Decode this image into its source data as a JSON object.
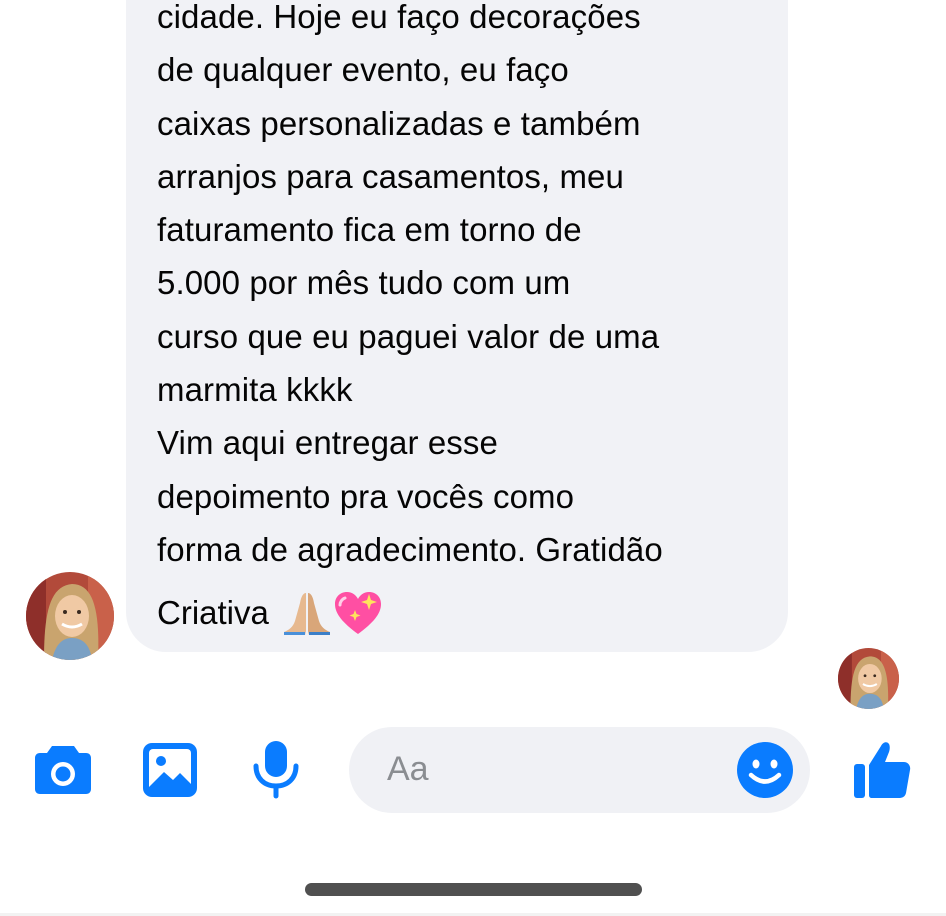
{
  "message": {
    "text": "cidade. Hoje eu faço decorações\nde qualquer evento, eu faço\ncaixas personalizadas e também\narranjos para casamentos, meu\nfaturamento fica em torno de\n5.000 por mês tudo com um\ncurso que eu paguei valor de uma\nmarmita kkkk\nVim aqui entregar esse\ndepoimento pra vocês como\nforma de agradecimento. Gratidão",
    "last_word": "Criativa",
    "emojis": [
      "folded-hands-icon",
      "sparkling-heart-icon"
    ]
  },
  "composer": {
    "placeholder": "Aa",
    "icons": [
      "camera-icon",
      "gallery-icon",
      "microphone-icon",
      "emoji-icon",
      "thumbs-up-icon"
    ]
  },
  "colors": {
    "accent": "#0a7cff",
    "bubble": "#f1f2f6",
    "input_bg": "#f0f1f5",
    "text": "#050505",
    "placeholder": "#8a8d91"
  }
}
